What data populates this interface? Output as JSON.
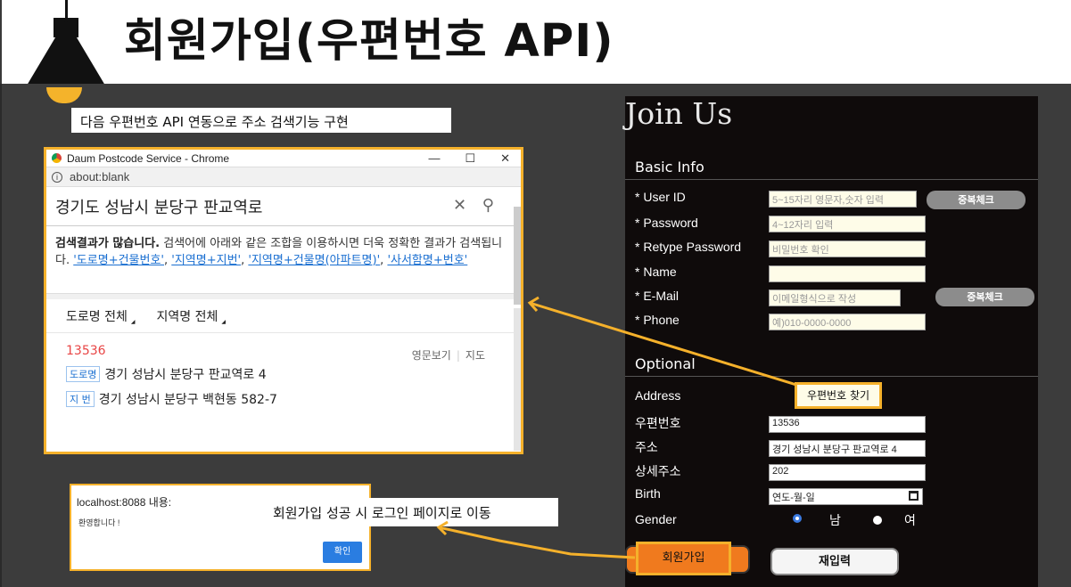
{
  "slide": {
    "title": "회원가입(우편번호 API)",
    "caption": "다음 우편번호 API 연동으로 주소 검색기능 구현",
    "alert_note": "회원가입 성공 시 로그인 페이지로 이동"
  },
  "popup": {
    "window_title": "Daum Postcode Service - Chrome",
    "minimize": "—",
    "maximize": "☐",
    "close": "✕",
    "url": "about:blank",
    "search_value": "경기도 성남시 분당구 판교역로",
    "search_icons": "✕ ⚲",
    "msg_bold": "검색결과가 많습니다.",
    "msg_text": " 검색어에 아래와 같은 조합을 이용하시면 더욱 정확한 결과가 검색됩니다. ",
    "links": [
      "'도로명+건물번호'",
      "'지역명+지번'",
      "'지역명+건물명(아파트명)'",
      "'사서함명+번호'"
    ],
    "tab_road": "도로명 전체",
    "tab_region": "지역명 전체",
    "result_zip": "13536",
    "link_english": "영문보기",
    "link_map": "지도",
    "road_tag": "도로명",
    "road_addr": "경기 성남시 분당구 판교역로 4",
    "jibun_tag": "지 번",
    "jibun_addr": "경기 성남시 분당구 백현동 582-7"
  },
  "alert": {
    "host": "localhost:8088 내용:",
    "message": "환영합니다 !",
    "ok": "확인"
  },
  "form": {
    "heading": "Join Us",
    "basic_info": "Basic Info",
    "optional": "Optional",
    "labels": {
      "user_id": "* User ID",
      "password": "* Password",
      "retype": "* Retype Password",
      "name": "* Name",
      "email": "* E-Mail",
      "phone": "* Phone",
      "address": "Address",
      "zip": "우편번호",
      "addr": "주소",
      "detail": "상세주소",
      "birth": "Birth",
      "gender": "Gender"
    },
    "placeholders": {
      "user_id": "5~15자리 영문자,숫자 입력",
      "password": "4~12자리 입력",
      "retype": "비밀번호 확인",
      "email": "이메일형식으로 작성",
      "phone": "예)010-0000-0000",
      "birth": "연도-월-일"
    },
    "values": {
      "zip": "13536",
      "addr": "경기 성남시 분당구 판교역로 4",
      "detail": "202"
    },
    "dup_check": "중복체크",
    "find_zip": "우편번호 찾기",
    "gender_male": "남",
    "gender_female": "여",
    "submit": "회원가입",
    "reset": "재입력"
  }
}
